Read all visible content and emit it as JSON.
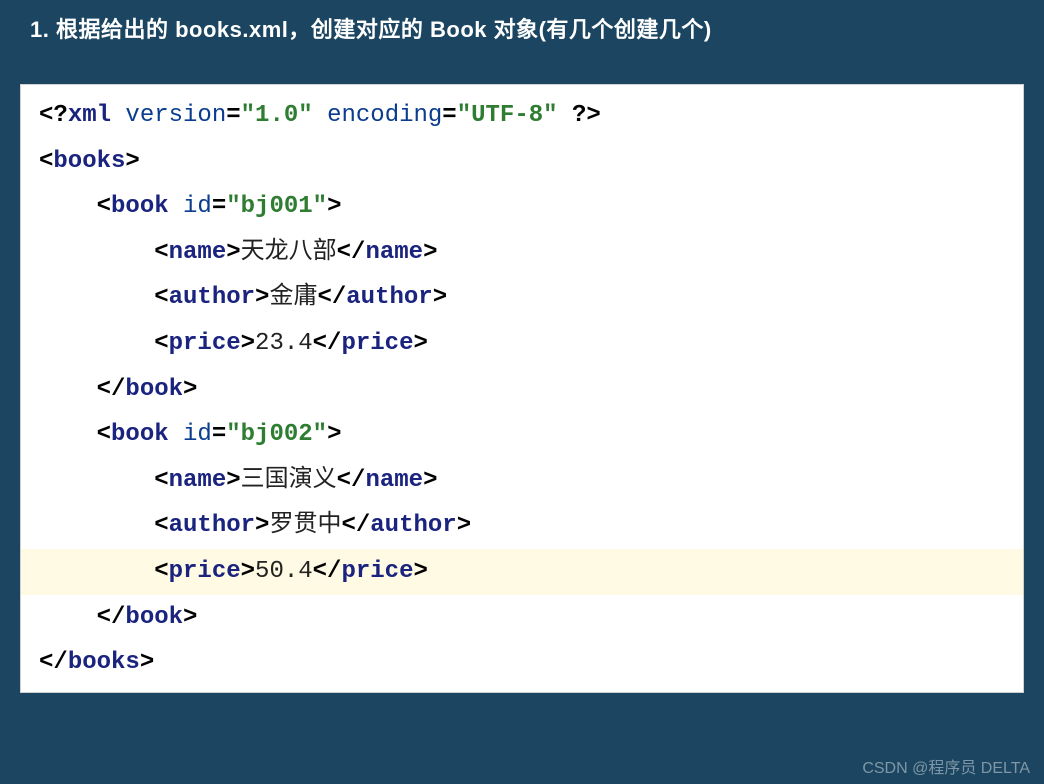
{
  "heading": "1.  根据给出的 books.xml，创建对应的 Book 对象(有几个创建几个)",
  "xml_decl_version_attr": "version",
  "xml_decl_version_val": "\"1.0\"",
  "xml_decl_encoding_attr": "encoding",
  "xml_decl_encoding_val": "\"UTF-8\"",
  "tag_books": "books",
  "tag_book": "book",
  "tag_name": "name",
  "tag_author": "author",
  "tag_price": "price",
  "attr_id": "id",
  "book1_id": "\"bj001\"",
  "book1_name": "天龙八部",
  "book1_author": "金庸",
  "book1_price": "23.4",
  "book2_id": "\"bj002\"",
  "book2_name": "三国演义",
  "book2_author": "罗贯中",
  "book2_price": "50.4",
  "watermark": "CSDN @程序员 DELTA"
}
